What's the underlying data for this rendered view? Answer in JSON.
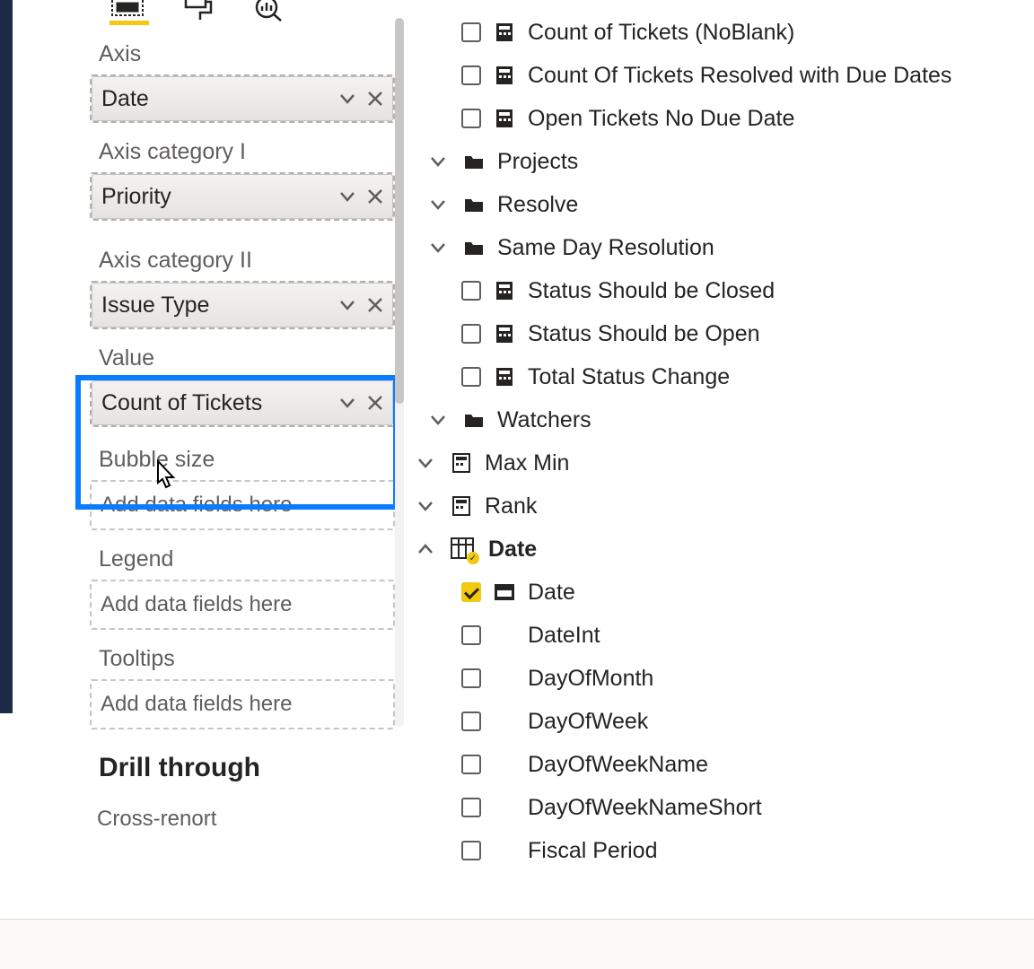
{
  "viz": {
    "axis": {
      "label": "Axis",
      "value": "Date"
    },
    "axis_cat1": {
      "label": "Axis category I",
      "value": "Priority"
    },
    "axis_cat2": {
      "label": "Axis category II",
      "value": "Issue Type"
    },
    "value": {
      "label": "Value",
      "value": "Count of Tickets"
    },
    "bubble": {
      "label": "Bubble size",
      "placeholder": "Add data fields here"
    },
    "legend": {
      "label": "Legend",
      "placeholder": "Add data fields here"
    },
    "tooltips": {
      "label": "Tooltips",
      "placeholder": "Add data fields here"
    },
    "drill": "Drill through",
    "cross": "Cross-renort"
  },
  "fields": {
    "measures_top": [
      "Count of Tickets (NoBlank)",
      "Count Of Tickets Resolved with Due Dates",
      "Open Tickets No Due Date"
    ],
    "projects": "Projects",
    "resolve": "Resolve",
    "sameday": {
      "label": "Same Day Resolution",
      "children": [
        "Status Should be Closed",
        "Status Should be Open",
        "Total Status Change"
      ]
    },
    "watchers": "Watchers",
    "maxmin": "Max Min",
    "rank": "Rank",
    "date_table": {
      "label": "Date",
      "children": [
        {
          "name": "Date",
          "checked": true,
          "hier": true
        },
        {
          "name": "DateInt"
        },
        {
          "name": "DayOfMonth"
        },
        {
          "name": "DayOfWeek"
        },
        {
          "name": "DayOfWeekName"
        },
        {
          "name": "DayOfWeekNameShort"
        },
        {
          "name": "Fiscal Period"
        }
      ]
    }
  }
}
